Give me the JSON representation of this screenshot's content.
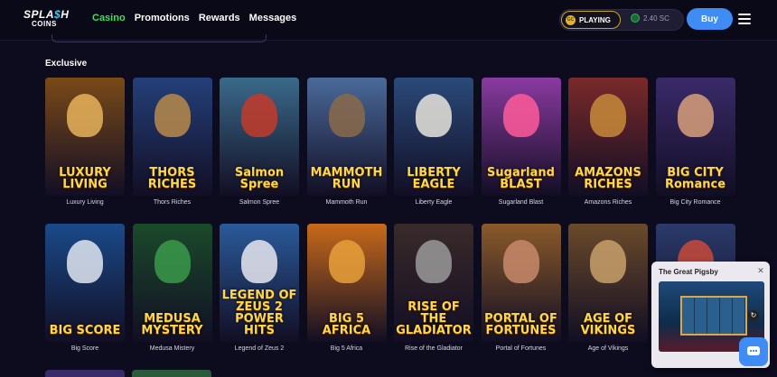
{
  "brand": {
    "line1a": "SPLA",
    "line1b": "$",
    "line1c": "H",
    "line2": "COINS"
  },
  "nav": {
    "casino": "Casino",
    "promotions": "Promotions",
    "rewards": "Rewards",
    "messages": "Messages"
  },
  "status": {
    "gc_coin": "GC",
    "playing_label": "PLAYING",
    "sc_value": "2.40 SC"
  },
  "buy_label": "Buy",
  "section": {
    "title": "Exclusive"
  },
  "colors": {
    "accent_green": "#3fe05e",
    "buy_blue": "#3f8cf5",
    "background": "#0d0b1e"
  },
  "games_row1": [
    {
      "art": "LUXURY LIVING",
      "label": "Luxury Living",
      "bg": "#7a4a18",
      "fig": "#e6b35a"
    },
    {
      "art": "THORS RICHES",
      "label": "Thors Riches",
      "bg": "#24407a",
      "fig": "#b88a4a"
    },
    {
      "art": "Salmon Spree",
      "label": "Salmon Spree",
      "bg": "#3a6a8a",
      "fig": "#c43a2a"
    },
    {
      "art": "MAMMOTH RUN",
      "label": "Mammoth Run",
      "bg": "#4a6a9a",
      "fig": "#8a6a4a"
    },
    {
      "art": "LIBERTY EAGLE",
      "label": "Liberty Eagle",
      "bg": "#2a4a7a",
      "fig": "#e8e4dc"
    },
    {
      "art": "Sugarland BLAST",
      "label": "Sugarland Blast",
      "bg": "#8a3aa0",
      "fig": "#ff5a9a"
    },
    {
      "art": "AMAZONS RICHES",
      "label": "Amazons Riches",
      "bg": "#7a2a2a",
      "fig": "#c8893a"
    },
    {
      "art": "BIG CITY Romance",
      "label": "Big City Romance",
      "bg": "#3a2a6a",
      "fig": "#d8a07a"
    }
  ],
  "games_row2": [
    {
      "art": "BIG SCORE",
      "label": "Big Score",
      "bg": "#1a4a8a",
      "fig": "#e0e6f0"
    },
    {
      "art": "MEDUSA MYSTERY",
      "label": "Medusa Mistery",
      "bg": "#1a4a2a",
      "fig": "#3a9a4a"
    },
    {
      "art": "LEGEND OF ZEUS 2 POWER HITS",
      "label": "Legend of Zeus 2",
      "bg": "#2a5a9a",
      "fig": "#e8e8f0"
    },
    {
      "art": "BIG 5 AFRICA",
      "label": "Big 5 Africa",
      "bg": "#c86a1a",
      "fig": "#e8a03a"
    },
    {
      "art": "RISE OF THE GLADIATOR",
      "label": "Rise of the Gladiator",
      "bg": "#3a2a2a",
      "fig": "#9a9a9a"
    },
    {
      "art": "PORTAL OF FORTUNES",
      "label": "Portal of Fortunes",
      "bg": "#8a5a2a",
      "fig": "#c88a6a"
    },
    {
      "art": "AGE OF VIKINGS",
      "label": "Age of Vikings",
      "bg": "#6a4a2a",
      "fig": "#c8a06a"
    },
    {
      "art": "",
      "label": "",
      "bg": "#2a3a6a",
      "fig": "#c84a3a"
    }
  ],
  "popup": {
    "title": "The Great Pigsby",
    "close": "✕",
    "replay": "↻"
  }
}
